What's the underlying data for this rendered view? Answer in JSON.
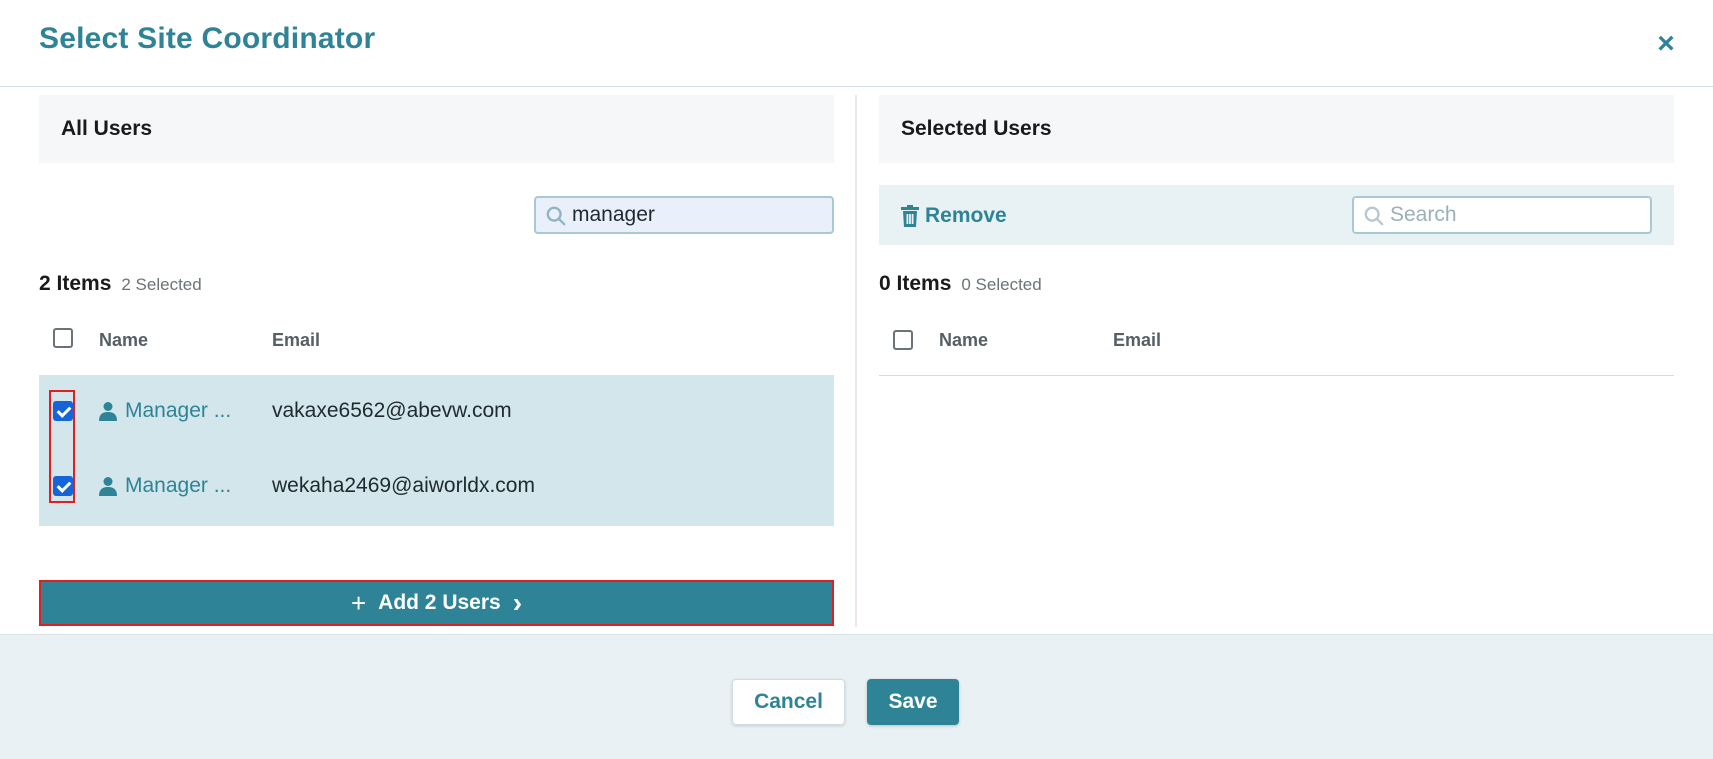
{
  "dialog": {
    "title": "Select Site Coordinator",
    "close_label": "×"
  },
  "all_users": {
    "heading": "All Users",
    "search": {
      "value": "manager",
      "placeholder": "Search"
    },
    "count_label": "2 Items",
    "selected_label": "2 Selected",
    "columns": {
      "name": "Name",
      "email": "Email"
    },
    "rows": [
      {
        "name": "Manager ...",
        "email": "vakaxe6562@abevw.com",
        "checked": true
      },
      {
        "name": "Manager ...",
        "email": "wekaha2469@aiworldx.com",
        "checked": true
      }
    ],
    "add_button": {
      "plus": "+",
      "label": "Add 2 Users",
      "chevron": "›"
    }
  },
  "selected_users": {
    "heading": "Selected Users",
    "remove_label": "Remove",
    "search": {
      "value": "",
      "placeholder": "Search"
    },
    "count_label": "0 Items",
    "selected_label": "0 Selected",
    "columns": {
      "name": "Name",
      "email": "Email"
    }
  },
  "footer": {
    "cancel_label": "Cancel",
    "save_label": "Save"
  },
  "colors": {
    "accent": "#2e8496",
    "row_selected": "#d3e6eb",
    "highlight": "#e02020"
  },
  "icons": [
    "close-icon",
    "search-icon",
    "trash-icon",
    "user-icon",
    "plus-icon",
    "chevron-right-icon"
  ]
}
